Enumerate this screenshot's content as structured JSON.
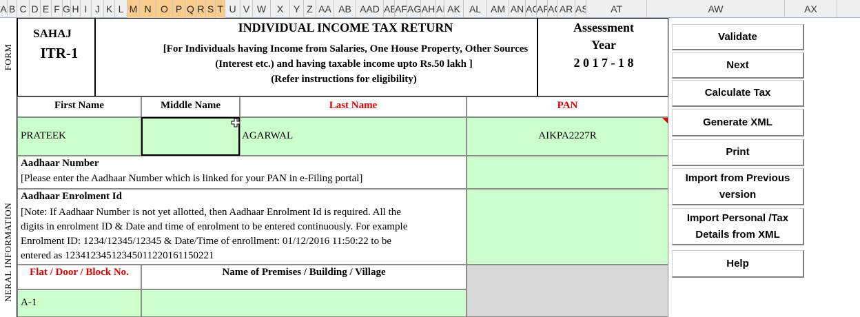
{
  "columns": [
    "A",
    "B",
    "C",
    "D",
    "E",
    "F",
    "G",
    "H",
    "I",
    "J",
    "K",
    "L",
    "M",
    "N",
    "O",
    "P",
    "Q",
    "R",
    "S",
    "T",
    "U",
    "V",
    "W",
    "X",
    "Y",
    "Z",
    "AA",
    "AB",
    "AC",
    "AD",
    "AE",
    "AF",
    "AG",
    "AH",
    "AI",
    "AK",
    "AL",
    "AM",
    "AN",
    "AO",
    "AP",
    "AQ",
    "AR",
    "AS",
    "AT",
    "AW",
    "AX"
  ],
  "columns_display": [
    "A",
    "B",
    "C",
    "D",
    "E",
    "F",
    "G",
    "H",
    "I",
    "J",
    "K",
    "L",
    "M",
    "N",
    "O",
    "P",
    "Q",
    "R",
    "S",
    "T",
    "U",
    "V",
    "W",
    "X",
    "Y",
    "Z",
    "AA",
    "AB",
    "AAD",
    "AE",
    "AF",
    "AG",
    "AH",
    "AI",
    "AK",
    "AL",
    "AM",
    "AN",
    "AC",
    "AF",
    "AG",
    "AR",
    "AS",
    "AT",
    "AW",
    "AX"
  ],
  "side_labels": {
    "form": "FORM",
    "general_info": "NERAL INFORMATION"
  },
  "form_box": {
    "line1": "SAHAJ",
    "line2": "ITR-1"
  },
  "title": {
    "main": "INDIVIDUAL INCOME TAX RETURN",
    "sub1": "[For Individuals having Income from Salaries, One House Property, Other Sources",
    "sub2": "(Interest  etc.) and  having taxable income upto Rs.50 lakh ]",
    "sub3": "(Refer instructions for eligibility)"
  },
  "assessment": {
    "line1": "Assessment",
    "line2": "Year",
    "line3": "2 0 1 7 - 1 8"
  },
  "name_headers": {
    "first": "First Name",
    "middle": "Middle Name",
    "last": "Last Name",
    "pan": "PAN"
  },
  "name_values": {
    "first": "PRATEEK",
    "middle": "",
    "last": "AGARWAL",
    "pan": "AIKPA2227R"
  },
  "aadhaar": {
    "label": "Aadhaar Number",
    "note": "[Please enter the Aadhaar Number which is linked for your PAN in e-Filing portal]",
    "value": ""
  },
  "enrolment": {
    "label": "Aadhaar Enrolment Id",
    "note1": "[Note: If Aadhaar Number is not yet allotted, then Aadhaar Enrolment Id is required. All the",
    "note2": "digits in enrolment ID & Date and time of enrolment to be entered continuously. For example",
    "note3": "Enrolment ID: 1234/12345/12345 & Date/Time of enrollment: 01/12/2016 11:50:22 to be",
    "note4": "entered as 12341234512345011220161150221",
    "value": ""
  },
  "address_headers": {
    "flat": "Flat / Door / Block No.",
    "premises": "Name of Premises / Building / Village"
  },
  "address_values": {
    "flat": "A-1",
    "premises": ""
  },
  "buttons": {
    "validate": "Validate",
    "next": "Next",
    "calculate": "Calculate Tax",
    "generate_xml": "Generate XML",
    "print": "Print",
    "import_prev_1": "Import from Previous",
    "import_prev_2": "version",
    "import_personal_1": "Import Personal /Tax",
    "import_personal_2": "Details from XML",
    "help": "Help"
  },
  "colors": {
    "input_green": "#ccffcc",
    "header_red": "#e00000",
    "selected_col": "#f9cc8c"
  }
}
